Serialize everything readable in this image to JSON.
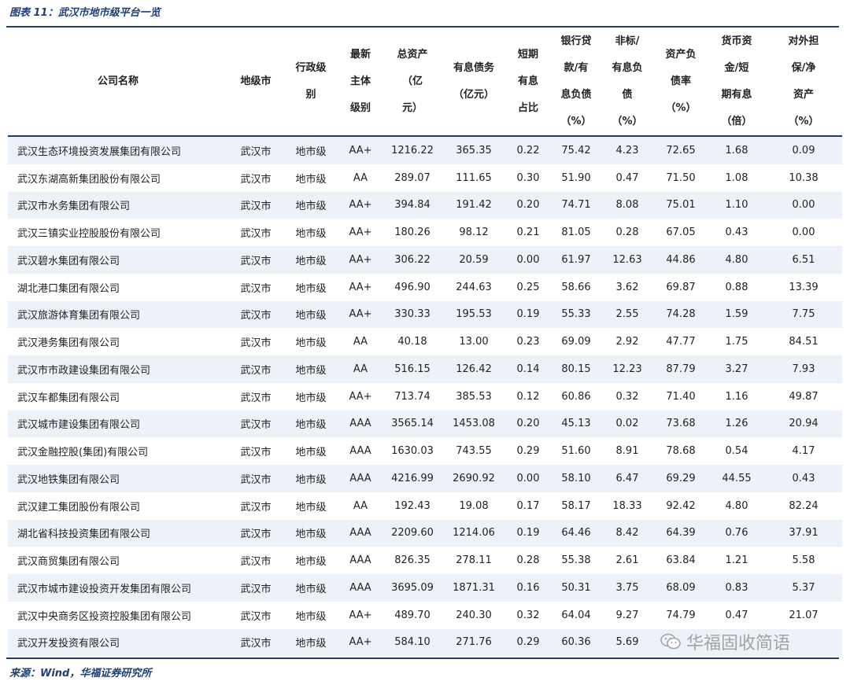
{
  "title": "图表 11：武汉市地市级平台一览",
  "headers": [
    [
      "公司名称"
    ],
    [
      "地级市"
    ],
    [
      "行政级",
      "别"
    ],
    [
      "最新",
      "主体",
      "级别"
    ],
    [
      "总资产",
      "（亿",
      "元）"
    ],
    [
      "有息债务",
      "（亿元）"
    ],
    [
      "短期",
      "有息",
      "占比"
    ],
    [
      "银行贷",
      "款/有",
      "息负债",
      "（%）"
    ],
    [
      "非标/",
      "有息负",
      "债",
      "（%）"
    ],
    [
      "资产负",
      "债率",
      "（%）"
    ],
    [
      "货币资",
      "金/短",
      "期有息",
      "（倍）"
    ],
    [
      "对外担",
      "保/净",
      "资产",
      "（%）"
    ]
  ],
  "rows": [
    [
      "武汉生态环境投资发展集团有限公司",
      "武汉市",
      "地市级",
      "AA+",
      "1216.22",
      "365.35",
      "0.22",
      "75.42",
      "4.23",
      "72.65",
      "1.68",
      "0.09"
    ],
    [
      "武汉东湖高新集团股份有限公司",
      "武汉市",
      "地市级",
      "AA",
      "289.07",
      "111.65",
      "0.30",
      "51.90",
      "0.47",
      "71.50",
      "1.08",
      "10.38"
    ],
    [
      "武汉市水务集团有限公司",
      "武汉市",
      "地市级",
      "AA+",
      "394.84",
      "191.42",
      "0.20",
      "74.71",
      "8.08",
      "75.01",
      "1.10",
      "0.00"
    ],
    [
      "武汉三镇实业控股股份有限公司",
      "武汉市",
      "地市级",
      "AA+",
      "180.26",
      "98.12",
      "0.21",
      "81.05",
      "0.28",
      "67.05",
      "0.43",
      "0.00"
    ],
    [
      "武汉碧水集团有限公司",
      "武汉市",
      "地市级",
      "AA+",
      "306.22",
      "20.59",
      "0.00",
      "61.97",
      "12.63",
      "44.86",
      "4.80",
      "6.51"
    ],
    [
      "湖北港口集团有限公司",
      "武汉市",
      "地市级",
      "AA+",
      "496.90",
      "244.63",
      "0.25",
      "58.66",
      "3.62",
      "69.87",
      "0.88",
      "13.39"
    ],
    [
      "武汉旅游体育集团有限公司",
      "武汉市",
      "地市级",
      "AA+",
      "330.33",
      "195.53",
      "0.19",
      "55.33",
      "2.55",
      "74.28",
      "1.59",
      "7.75"
    ],
    [
      "武汉港务集团有限公司",
      "武汉市",
      "地市级",
      "AA",
      "40.18",
      "13.00",
      "0.23",
      "69.09",
      "2.92",
      "47.77",
      "1.75",
      "84.51"
    ],
    [
      "武汉市市政建设集团有限公司",
      "武汉市",
      "地市级",
      "AA",
      "516.15",
      "126.42",
      "0.14",
      "80.15",
      "12.23",
      "87.79",
      "3.27",
      "7.93"
    ],
    [
      "武汉车都集团有限公司",
      "武汉市",
      "地市级",
      "AA+",
      "713.74",
      "385.53",
      "0.12",
      "60.86",
      "0.32",
      "71.40",
      "1.16",
      "49.87"
    ],
    [
      "武汉城市建设集团有限公司",
      "武汉市",
      "地市级",
      "AAA",
      "3565.14",
      "1453.08",
      "0.20",
      "45.13",
      "0.02",
      "73.68",
      "1.26",
      "20.94"
    ],
    [
      "武汉金融控股(集团)有限公司",
      "武汉市",
      "地市级",
      "AAA",
      "1630.03",
      "743.55",
      "0.29",
      "51.60",
      "8.91",
      "78.68",
      "0.54",
      "4.17"
    ],
    [
      "武汉地铁集团有限公司",
      "武汉市",
      "地市级",
      "AAA",
      "4216.99",
      "2690.92",
      "0.00",
      "58.10",
      "6.47",
      "69.29",
      "44.55",
      "0.43"
    ],
    [
      "武汉建工集团股份有限公司",
      "武汉市",
      "地市级",
      "AA",
      "192.43",
      "19.08",
      "0.17",
      "58.17",
      "18.33",
      "92.42",
      "4.80",
      "82.24"
    ],
    [
      "湖北省科技投资集团有限公司",
      "武汉市",
      "地市级",
      "AAA",
      "2209.60",
      "1214.06",
      "0.19",
      "64.46",
      "8.42",
      "64.39",
      "0.76",
      "37.91"
    ],
    [
      "武汉商贸集团有限公司",
      "武汉市",
      "地市级",
      "AAA",
      "826.35",
      "278.11",
      "0.28",
      "55.38",
      "2.61",
      "63.84",
      "1.21",
      "5.58"
    ],
    [
      "武汉市城市建设投资开发集团有限公司",
      "武汉市",
      "地市级",
      "AAA",
      "3695.09",
      "1871.31",
      "0.16",
      "50.31",
      "3.75",
      "68.09",
      "0.83",
      "5.37"
    ],
    [
      "武汉中央商务区投资控股集团有限公司",
      "武汉市",
      "地市级",
      "AA+",
      "489.70",
      "240.30",
      "0.32",
      "64.04",
      "9.27",
      "74.79",
      "0.47",
      "21.07"
    ],
    [
      "武汉开发投资有限公司",
      "武汉市",
      "地市级",
      "AA+",
      "584.10",
      "271.76",
      "0.29",
      "60.36",
      "5.69",
      "",
      "",
      ""
    ]
  ],
  "source": "来源：Wind，华福证券研究所",
  "watermark": "华福固收简语",
  "watermark_icon": "wechat-icon"
}
